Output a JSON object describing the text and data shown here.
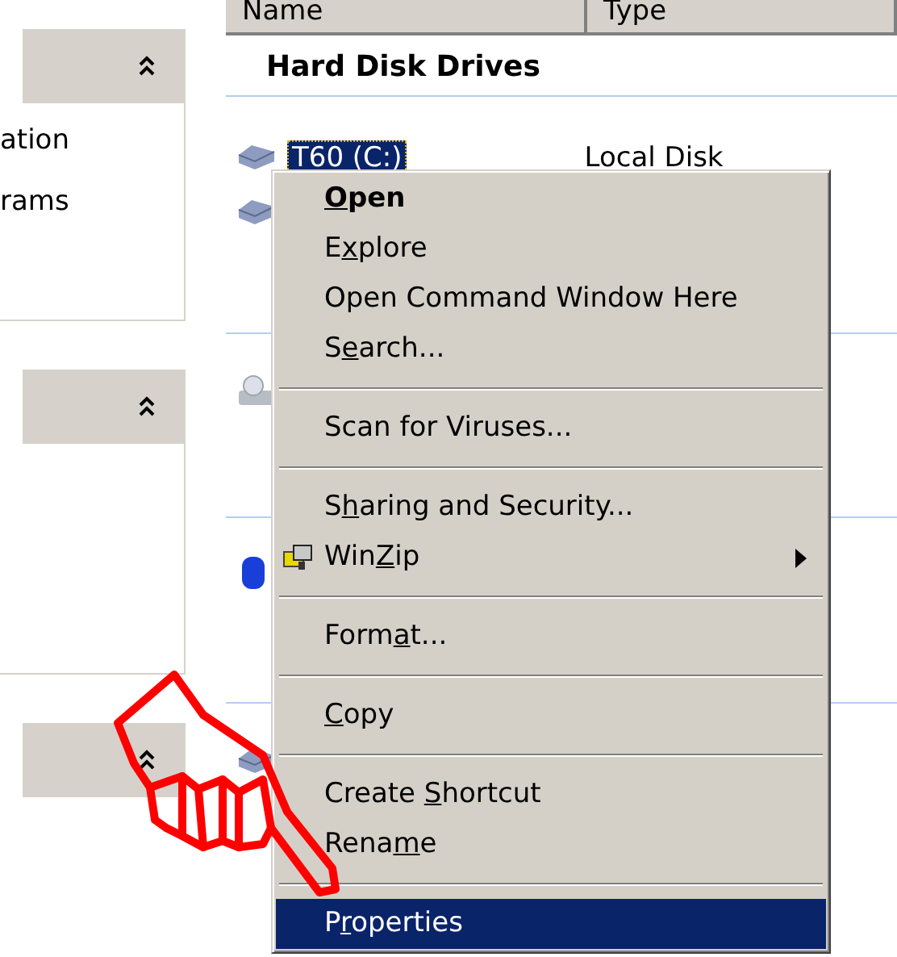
{
  "left_pane": {
    "sections": [
      {
        "expanded": true,
        "lines": [
          "ation",
          "rams"
        ]
      },
      {
        "expanded": true
      },
      {
        "expanded": true
      }
    ]
  },
  "file_list": {
    "columns": [
      "Name",
      "Type"
    ],
    "group": "Hard Disk Drives",
    "drive": {
      "name": "T60 (C:)",
      "type": "Local Disk",
      "selected": true
    }
  },
  "context_menu": {
    "items": [
      {
        "kind": "item",
        "key": "O",
        "after": "pen",
        "default": true,
        "selected": false
      },
      {
        "kind": "item",
        "before": "E",
        "key": "x",
        "after": "plore",
        "default": false,
        "selected": false
      },
      {
        "kind": "item",
        "before": "Open Command Window Here",
        "default": false,
        "selected": false
      },
      {
        "kind": "item",
        "before": "S",
        "key": "e",
        "after": "arch...",
        "default": false,
        "selected": false
      },
      {
        "kind": "separator"
      },
      {
        "kind": "item",
        "before": "Scan for Viruses...",
        "default": false,
        "selected": false
      },
      {
        "kind": "separator"
      },
      {
        "kind": "item",
        "before": "S",
        "key": "h",
        "after": "aring and Security...",
        "default": false,
        "selected": false
      },
      {
        "kind": "item",
        "before": "Win",
        "key": "Z",
        "after": "ip",
        "default": false,
        "selected": false,
        "icon": true,
        "submenu": true
      },
      {
        "kind": "separator"
      },
      {
        "kind": "item",
        "before": "Form",
        "key": "a",
        "after": "t...",
        "default": false,
        "selected": false
      },
      {
        "kind": "separator"
      },
      {
        "kind": "item",
        "key": "C",
        "after": "opy",
        "default": false,
        "selected": false
      },
      {
        "kind": "separator"
      },
      {
        "kind": "item",
        "before": "Create ",
        "key": "S",
        "after": "hortcut",
        "default": false,
        "selected": false
      },
      {
        "kind": "item",
        "before": "Rena",
        "key": "m",
        "after": "e",
        "default": false,
        "selected": false
      },
      {
        "kind": "separator"
      },
      {
        "kind": "item",
        "before": "P",
        "key": "r",
        "after": "operties",
        "default": false,
        "selected": true
      }
    ]
  }
}
